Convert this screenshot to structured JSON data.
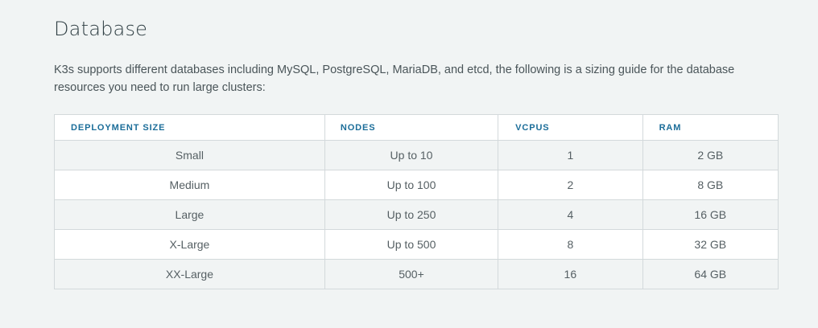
{
  "section": {
    "title": "Database",
    "intro": "K3s supports different databases including MySQL, PostgreSQL, MariaDB, and etcd, the following is a sizing guide for the database resources you need to run large clusters:"
  },
  "table": {
    "headers": [
      "DEPLOYMENT SIZE",
      "NODES",
      "VCPUS",
      "RAM"
    ],
    "rows": [
      [
        "Small",
        "Up to 10",
        "1",
        "2 GB"
      ],
      [
        "Medium",
        "Up to 100",
        "2",
        "8 GB"
      ],
      [
        "Large",
        "Up to 250",
        "4",
        "16 GB"
      ],
      [
        "X-Large",
        "Up to 500",
        "8",
        "32 GB"
      ],
      [
        "XX-Large",
        "500+",
        "16",
        "64 GB"
      ]
    ]
  },
  "colors": {
    "header_text": "#1b6d99",
    "background": "#f1f4f4",
    "stripe": "#ffffff"
  }
}
